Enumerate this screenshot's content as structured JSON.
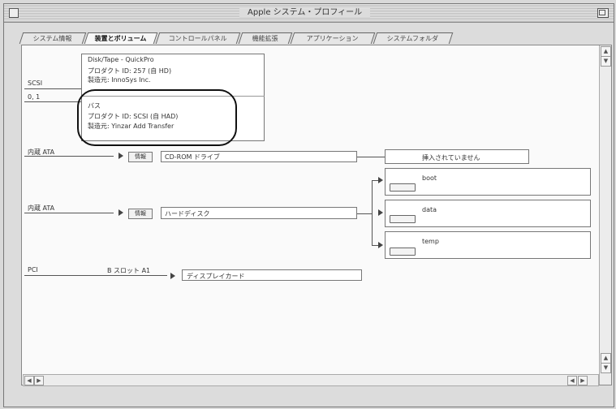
{
  "window": {
    "title": "Apple システム・プロフィール"
  },
  "tabs": [
    {
      "label": "システム情報",
      "active": false
    },
    {
      "label": "装置とボリューム",
      "active": true
    },
    {
      "label": "コントロールパネル",
      "active": false
    },
    {
      "label": "機能拡張",
      "active": false
    },
    {
      "label": "アプリケーション",
      "active": false
    },
    {
      "label": "システムフォルダ",
      "active": false
    }
  ],
  "scsi": {
    "bus_label": "SCSI",
    "bus_id": "0, 1",
    "device_type": "Disk/Tape - QuickPro",
    "product_line": "プロダクト ID: 257 (自 HD)",
    "vendor_line": "製造元: InnoSys Inc.",
    "media_title": "バス",
    "media_product_line": "プロダクト ID: SCSI (自 HAD)",
    "media_vendor_line": "製造元: Yinzar Add Transfer"
  },
  "ata1": {
    "label": "内蔵 ATA",
    "info_button": "情報",
    "device_name": "CD-ROM ドライブ",
    "status_text": "挿入されていません"
  },
  "ata2": {
    "label": "内蔵 ATA",
    "info_button": "情報",
    "device_name": "ハードディスク",
    "volumes": [
      "boot",
      "data",
      "temp"
    ]
  },
  "pci": {
    "label": "PCI",
    "slot_label": "B スロット A1",
    "device_name": "ディスプレイカード"
  },
  "colors": {
    "panel_bg": "#fafafa",
    "window_bg": "#dcdcdc",
    "annotation": "#111111"
  }
}
